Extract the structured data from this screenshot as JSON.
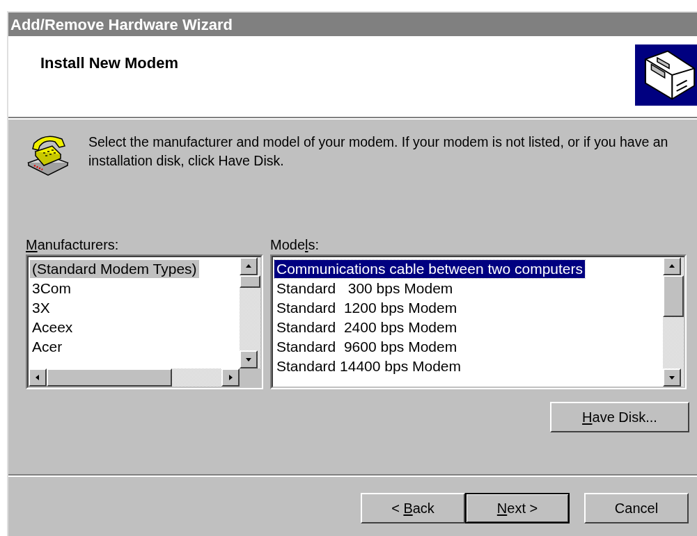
{
  "window": {
    "title": "Add/Remove Hardware Wizard"
  },
  "header": {
    "title": "Install New Modem"
  },
  "instructions": "Select the manufacturer and model of your modem. If your modem is not listed, or if you have an installation disk, click Have Disk.",
  "manufacturers": {
    "label": "Manufacturers:",
    "items": [
      {
        "text": "(Standard Modem Types)",
        "selected": true
      },
      {
        "text": "3Com",
        "selected": false
      },
      {
        "text": "3X",
        "selected": false
      },
      {
        "text": "Aceex",
        "selected": false
      },
      {
        "text": "Acer",
        "selected": false
      }
    ]
  },
  "models": {
    "label": "Models:",
    "items": [
      {
        "text": "Communications cable between two computers",
        "selected": true
      },
      {
        "text": "Standard   300 bps Modem",
        "selected": false
      },
      {
        "text": "Standard  1200 bps Modem",
        "selected": false
      },
      {
        "text": "Standard  2400 bps Modem",
        "selected": false
      },
      {
        "text": "Standard  9600 bps Modem",
        "selected": false
      },
      {
        "text": "Standard 14400 bps Modem",
        "selected": false
      }
    ]
  },
  "have_disk": {
    "label": "Have Disk..."
  },
  "buttons": [
    {
      "label": "< Back",
      "default": false
    },
    {
      "label": "Next >",
      "default": true
    },
    {
      "label": "Cancel",
      "default": false
    }
  ]
}
